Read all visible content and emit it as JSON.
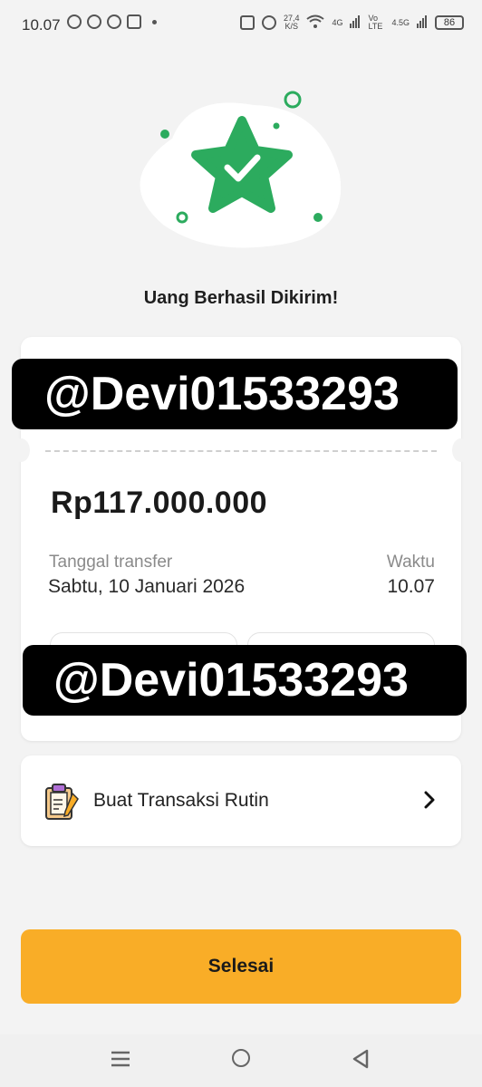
{
  "status_bar": {
    "time": "10.07",
    "speed_value": "27,4",
    "speed_unit": "K/S",
    "net_4g": "4G",
    "volte": "Vo LTE",
    "net_45g": "4.5G",
    "battery": "86"
  },
  "title": "Uang Berhasil Dikirim!",
  "watermark_text": "@Devi01533293",
  "receipt": {
    "amount": "Rp117.000.000",
    "date_label": "Tanggal transfer",
    "date_value": "Sabtu, 10 Januari 2026",
    "time_label": "Waktu",
    "time_value": "10.07"
  },
  "routine": {
    "label": "Buat Transaksi Rutin"
  },
  "done_button": "Selesai",
  "colors": {
    "success_green": "#2cab5e",
    "accent_yellow": "#f9ad27",
    "background": "#f3f3f3"
  },
  "icons": [
    "status-app-icon",
    "check-star-icon",
    "clipboard-icon",
    "chevron-right-icon",
    "menu-icon",
    "home-icon",
    "back-icon"
  ]
}
